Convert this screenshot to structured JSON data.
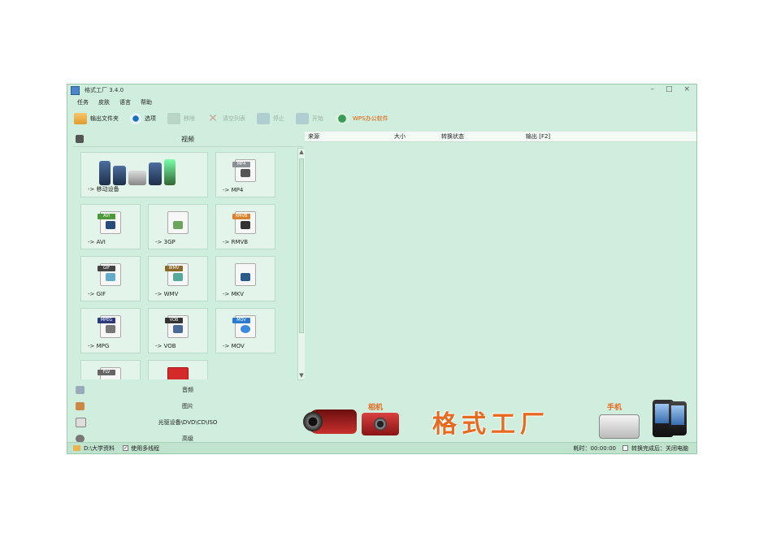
{
  "window": {
    "title": "格式工厂 3.4.0"
  },
  "menu": [
    "任务",
    "皮肤",
    "语言",
    "帮助"
  ],
  "toolbar": {
    "output_folder": "输出文件夹",
    "options": "选项",
    "remove": "移除",
    "clear_list": "清空列表",
    "stop": "停止",
    "start": "开始",
    "wps": "WPS办公软件"
  },
  "categories": {
    "video": "视频",
    "audio": "音频",
    "picture": "图片",
    "rom": "光驱设备\\DVD\\CD\\ISO",
    "advanced": "高级"
  },
  "tiles": [
    {
      "label": "-> 移动设备"
    },
    {
      "label": "-> MP4",
      "tag": "MP4"
    },
    {
      "label": "-> AVI",
      "tag": "AVI"
    },
    {
      "label": "-> 3GP",
      "tag": ""
    },
    {
      "label": "-> RMVB",
      "tag": "RMVB"
    },
    {
      "label": "-> GIF",
      "tag": "GIF"
    },
    {
      "label": "-> WMV",
      "tag": "WMV"
    },
    {
      "label": "-> MKV",
      "tag": ""
    },
    {
      "label": "-> MPG",
      "tag": "MPEG"
    },
    {
      "label": "-> VOB",
      "tag": "VOB"
    },
    {
      "label": "-> MOV",
      "tag": "MOV"
    },
    {
      "label": "",
      "tag": "FLV"
    },
    {
      "label": "",
      "tag": ""
    }
  ],
  "table": {
    "columns": [
      "来源",
      "大小",
      "转换状态",
      "输出 [F2]"
    ]
  },
  "banner": {
    "title": "格式工厂",
    "camera": "相机",
    "phone": "手机"
  },
  "status": {
    "output_path": "D:\\大学资料",
    "multithread": "使用多线程",
    "elapsed": "耗时：00:00:00",
    "after_convert": "转换完成后：关闭电脑"
  },
  "colors": {
    "window_bg": "#cfeedd",
    "banner_text": "#e66a20"
  }
}
